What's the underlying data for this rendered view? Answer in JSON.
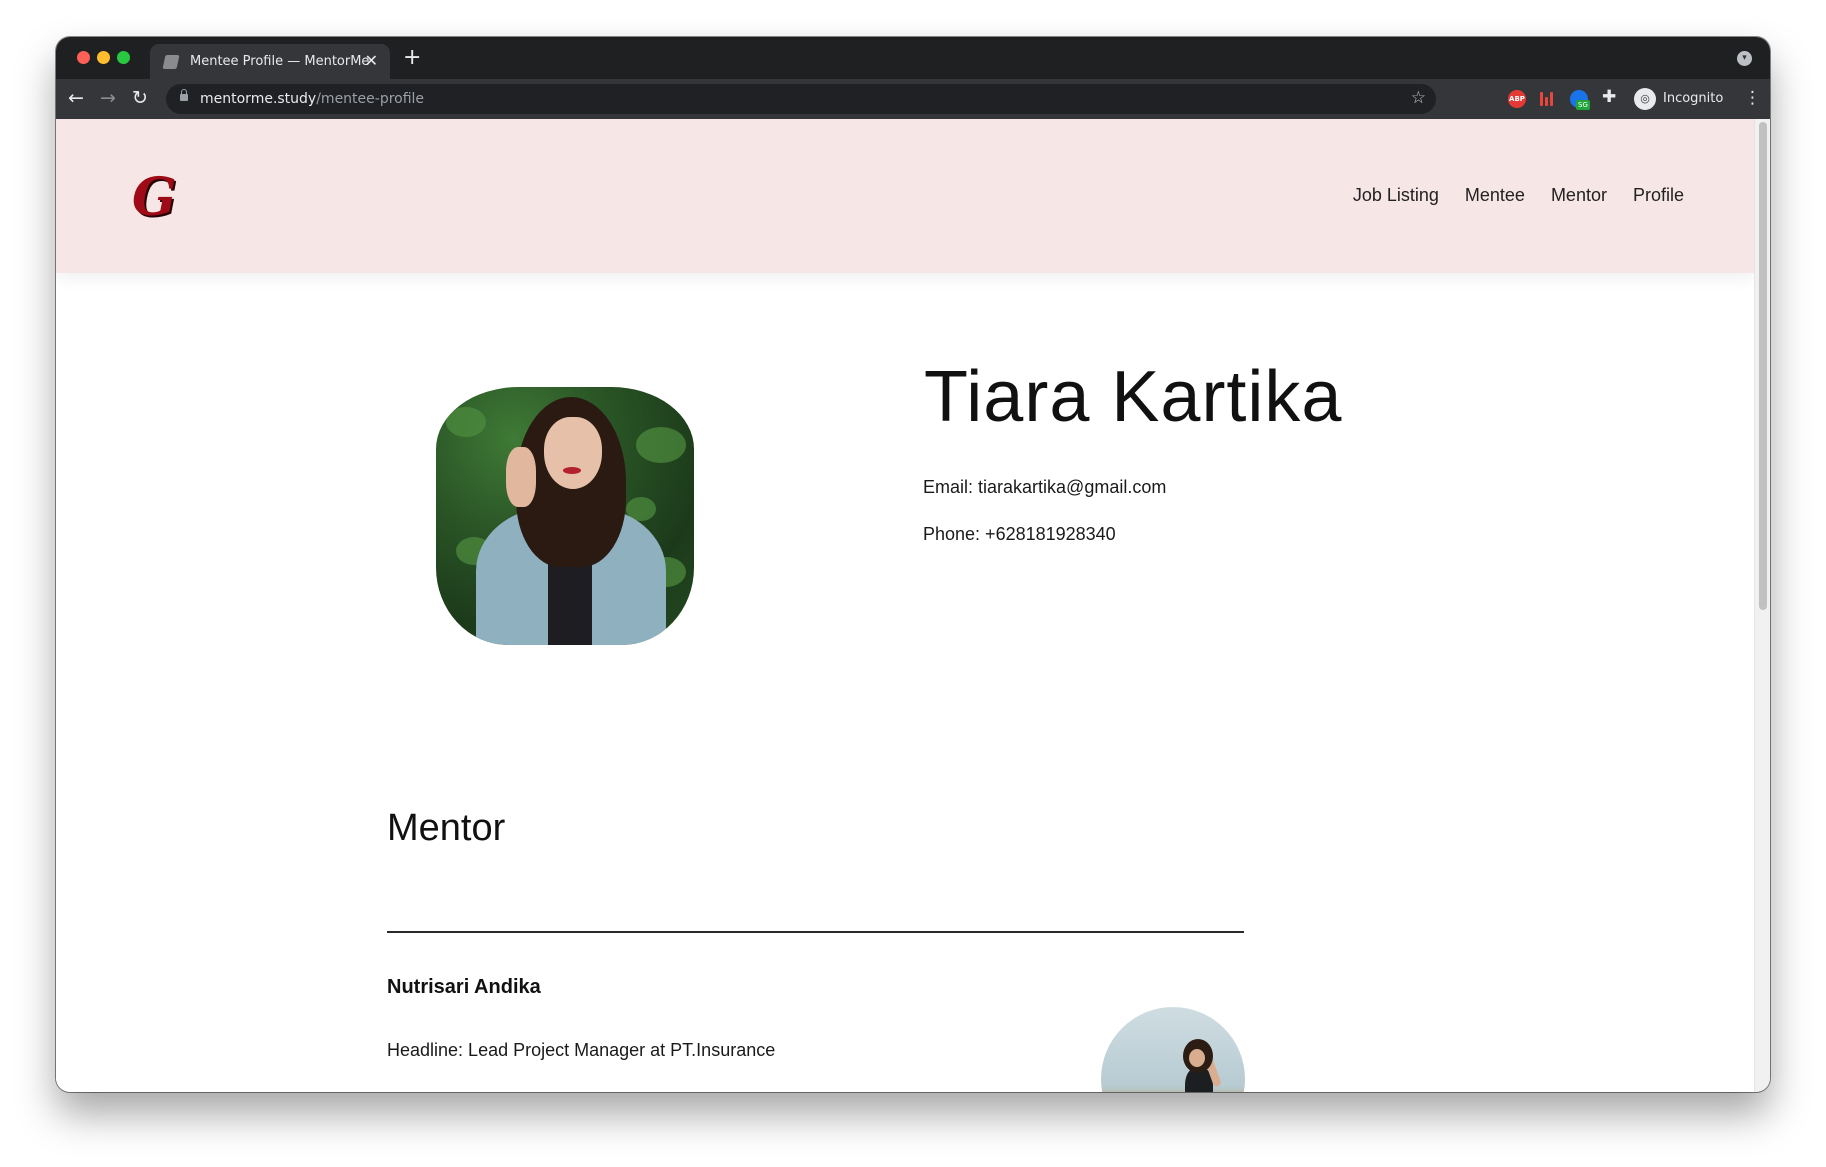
{
  "browser": {
    "tab": {
      "title": "Mentee Profile — MentorMe",
      "close_glyph": "✕",
      "favicon": "site-favicon-icon"
    },
    "new_tab_glyph": "+",
    "tab_search_glyph": "▾",
    "nav": {
      "back": "←",
      "forward": "→",
      "reload": "↻"
    },
    "address": {
      "host": "mentorme.study",
      "path": "/mentee-profile"
    },
    "bookmark_glyph": "☆",
    "extensions": {
      "adblock_label": "ABP",
      "sg_badge": "SG",
      "puzzle_glyph": "✚"
    },
    "incognito": {
      "glyph": "◎",
      "label": "Incognito"
    },
    "menu_glyph": "⋮"
  },
  "site": {
    "logo_text": "G",
    "nav": [
      {
        "label": "Job Listing"
      },
      {
        "label": "Mentee"
      },
      {
        "label": "Mentor"
      },
      {
        "label": "Profile"
      }
    ]
  },
  "profile": {
    "name": "Tiara Kartika",
    "email_line": "Email: tiarakartika@gmail.com",
    "phone_line": "Phone: +628181928340"
  },
  "mentor_section": {
    "heading": "Mentor",
    "mentor": {
      "name": "Nutrisari Andika",
      "headline_line": "Headline: Lead Project Manager at PT.Insurance"
    }
  },
  "colors": {
    "header_bg": "#f6e6e5",
    "logo": "#9e0b16",
    "chrome_dark": "#1f2022",
    "toolbar": "#35363a"
  }
}
